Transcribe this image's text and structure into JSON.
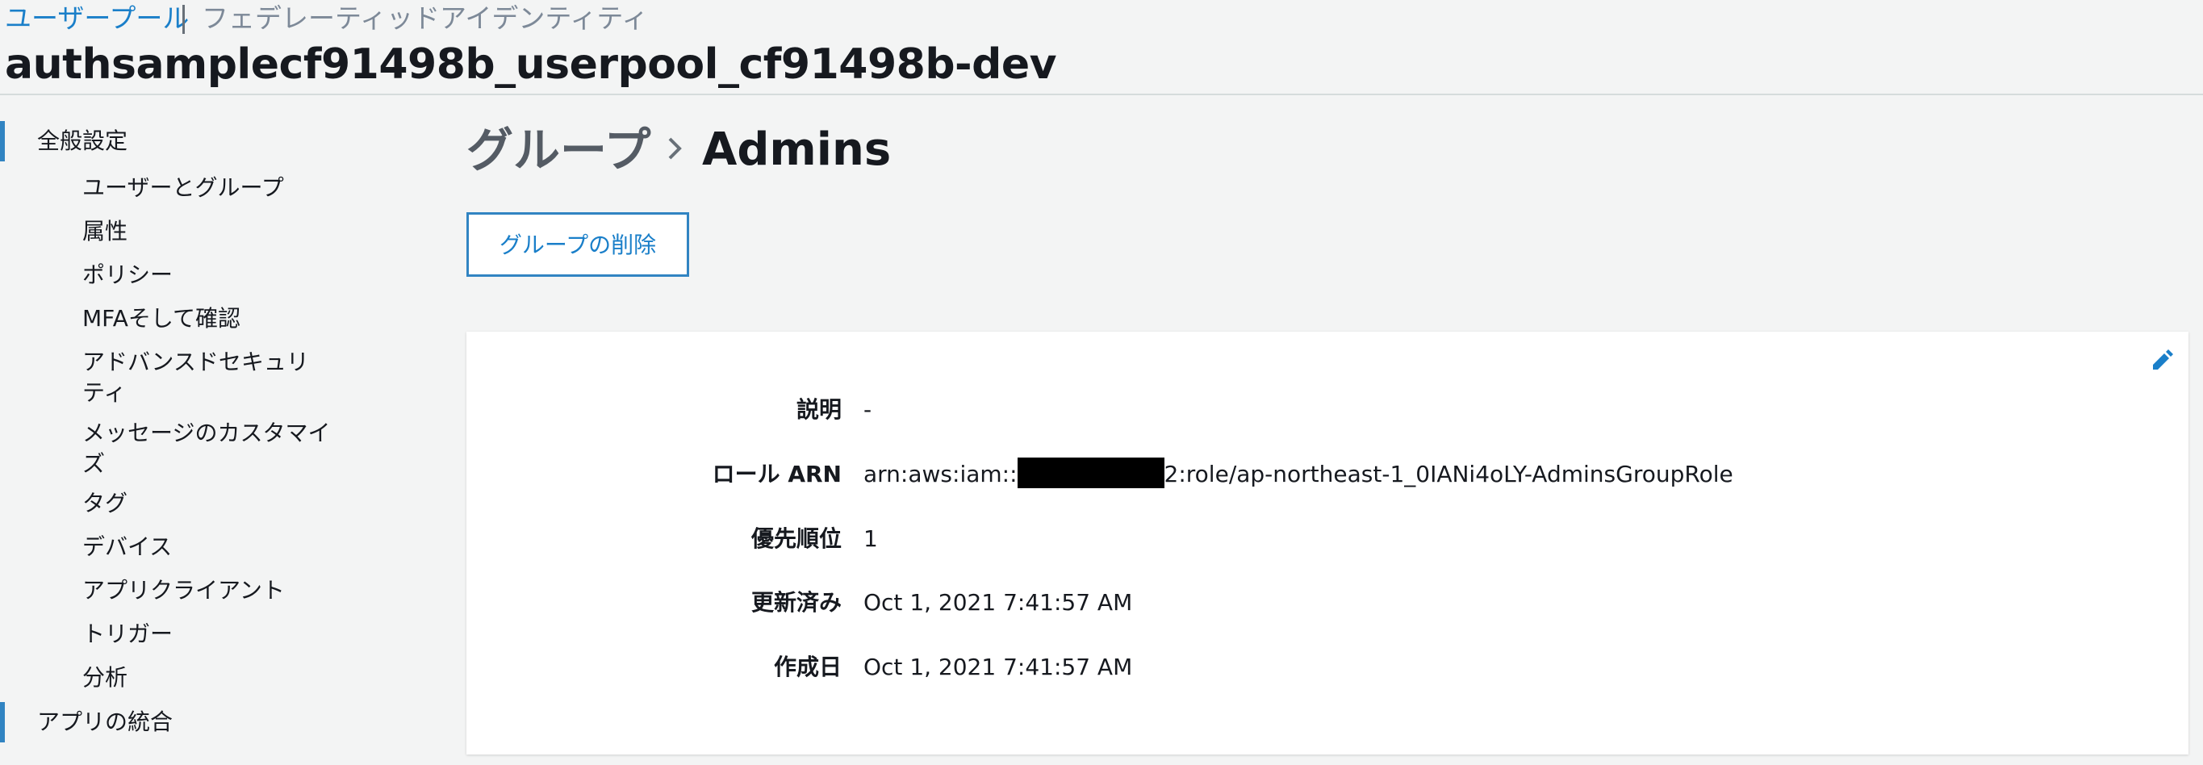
{
  "top_nav": {
    "active_tab": "ユーザープール",
    "inactive_tab": "フェデレーティッドアイデンティティ"
  },
  "pool_name": "authsamplecf91498b_userpool_cf91498b-dev",
  "sidebar": {
    "section_general": "全般設定",
    "items": [
      "ユーザーとグループ",
      "属性",
      "ポリシー",
      "MFAそして確認",
      "アドバンスドセキュリティ",
      "メッセージのカスタマイズ",
      "タグ",
      "デバイス",
      "アプリクライアント",
      "トリガー",
      "分析"
    ],
    "section_app_integration": "アプリの統合"
  },
  "breadcrumb": {
    "parent": "グループ",
    "current": "Admins"
  },
  "actions": {
    "delete_group": "グループの削除"
  },
  "details": {
    "description_label": "説明",
    "description_value": "-",
    "role_arn_label": "ロール ARN",
    "role_arn_prefix": "arn:aws:iam::",
    "role_arn_suffix": "2:role/ap-northeast-1_0IANi4oLY-AdminsGroupRole",
    "precedence_label": "優先順位",
    "precedence_value": "1",
    "updated_label": "更新済み",
    "updated_value": "Oct 1, 2021 7:41:57 AM",
    "created_label": "作成日",
    "created_value": "Oct 1, 2021 7:41:57 AM"
  },
  "colors": {
    "accent": "#1a7fc9",
    "sidebar_bar": "#3184c2",
    "background": "#f3f4f4",
    "text": "#16191f",
    "muted": "#7d8998"
  },
  "icons": {
    "edit": "pencil-icon",
    "breadcrumb_separator": "chevron-right-icon"
  }
}
